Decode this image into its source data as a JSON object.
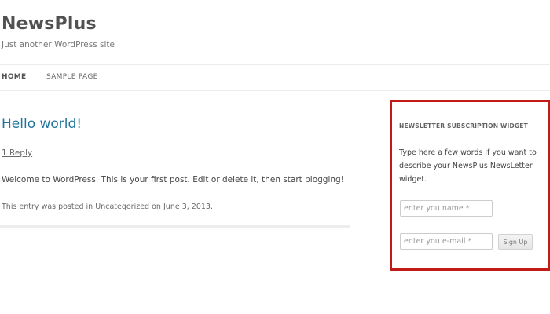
{
  "site": {
    "title": "NewsPlus",
    "description": "Just another WordPress site"
  },
  "nav": {
    "items": [
      {
        "label": "HOME",
        "active": true
      },
      {
        "label": "SAMPLE PAGE",
        "active": false
      }
    ]
  },
  "post": {
    "title": "Hello world!",
    "reply_link": "1 Reply",
    "content": "Welcome to WordPress. This is your first post. Edit or delete it, then start blogging!",
    "meta": {
      "prefix": "This entry was posted in",
      "category": "Uncategorized",
      "on_word": "on",
      "date": "June 3, 2013",
      "suffix": "."
    }
  },
  "widget": {
    "title": "NEWSLETTER SUBSCRIPTION WIDGET",
    "description": "Type here a few words if you want to describe your NewsPlus NewsLetter widget.",
    "name_input": {
      "value": "",
      "placeholder": "enter you name *"
    },
    "email_input": {
      "value": "",
      "placeholder": "enter you e-mail *"
    },
    "signup_label": "Sign Up",
    "highlight_color": "#c11b17"
  },
  "colors": {
    "link": "#21759b",
    "text": "#444444",
    "muted": "#6a6a6a"
  }
}
